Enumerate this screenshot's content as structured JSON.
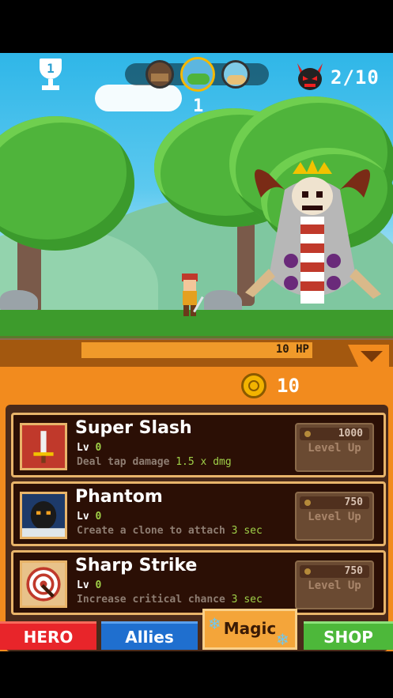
{
  "hud": {
    "trophy_count": "1",
    "stage_number": "1",
    "boss_counter": "2/10"
  },
  "hp_bar": {
    "text": "10 HP",
    "fill_fraction": 1.0
  },
  "currency": {
    "gold": "10"
  },
  "skills": [
    {
      "name": "Super Slash",
      "lv_label": "Lv",
      "lv_value": "0",
      "desc": "Deal tap damage",
      "desc_value": "1.5 x dmg",
      "cost": "1000",
      "button_label": "Level Up",
      "icon": "sword-icon"
    },
    {
      "name": "Phantom",
      "lv_label": "Lv",
      "lv_value": "0",
      "desc": "Create a clone to attach",
      "desc_value": "3 sec",
      "cost": "750",
      "button_label": "Level Up",
      "icon": "shadow-clone-icon"
    },
    {
      "name": "Sharp Strike",
      "lv_label": "Lv",
      "lv_value": "0",
      "desc": "Increase critical chance",
      "desc_value": "3 sec",
      "cost": "750",
      "button_label": "Level Up",
      "icon": "target-icon"
    }
  ],
  "tabs": {
    "hero": "HERO",
    "allies": "Allies",
    "magic": "Magic",
    "shop": "SHOP",
    "active": "magic"
  },
  "colors": {
    "panel_orange": "#f28b1e",
    "card_bg": "#2b0f05",
    "card_border": "#e8b46a",
    "tab_hero": "#e8252a",
    "tab_allies": "#1f6fcf",
    "tab_magic": "#f4a53a",
    "tab_shop": "#4db83a"
  }
}
